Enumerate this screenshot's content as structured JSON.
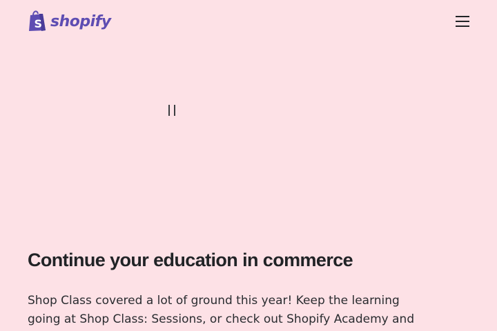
{
  "header": {
    "logo_text": "shopify",
    "logo_color": "#5e4db2",
    "menu_icon": "hamburger-menu-icon"
  },
  "media": {
    "pause_icon": "pause-icon"
  },
  "main": {
    "title": "Continue your education in commerce",
    "body": "Shop Class covered a lot of ground this year! Keep the learning going at Shop Class: Sessions, or check out Shopify Academy and our"
  },
  "colors": {
    "background": "#fde1e6",
    "text": "#212326"
  }
}
